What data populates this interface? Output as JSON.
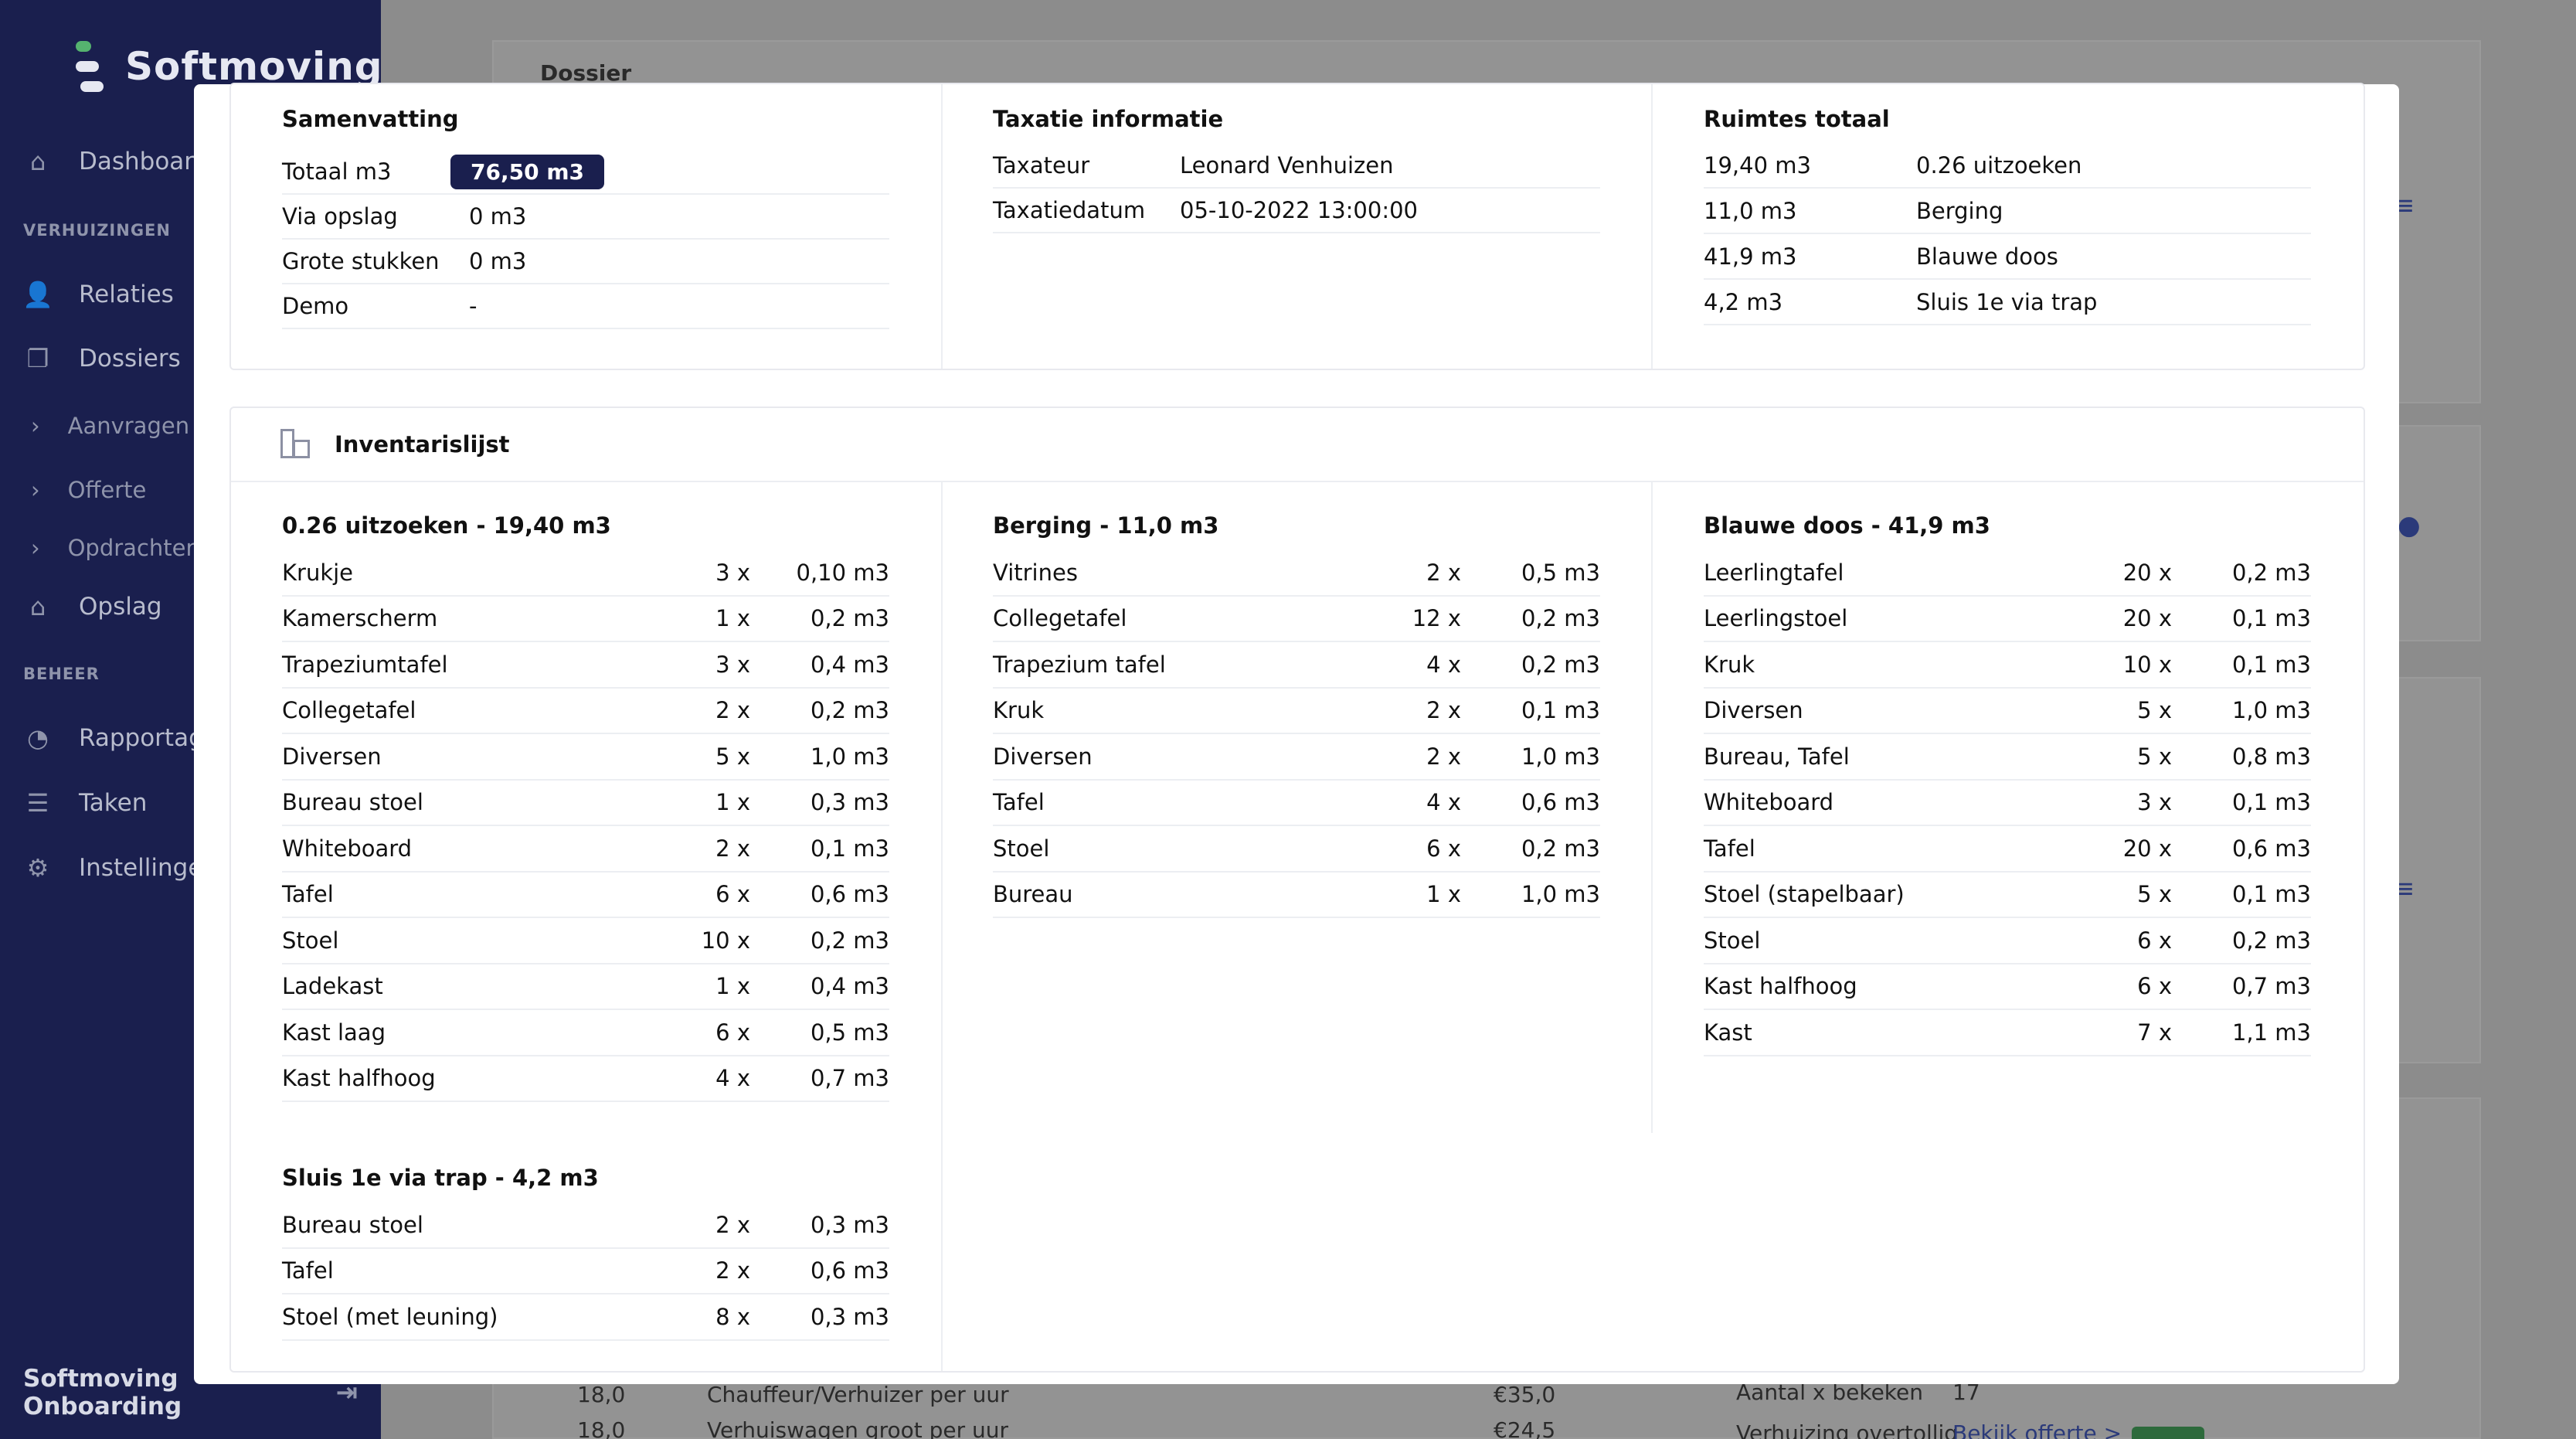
{
  "app": {
    "brand": "Softmoving",
    "account": "Softmoving Onboarding"
  },
  "sidebar": {
    "items": [
      {
        "label": "Dashboard",
        "icon": "home-icon"
      },
      {
        "label": "Relaties",
        "icon": "user-icon"
      },
      {
        "label": "Dossiers",
        "icon": "copy-icon"
      },
      {
        "label": "Aanvragen",
        "icon": "chevron-right-icon"
      },
      {
        "label": "Offerte",
        "icon": "chevron-right-icon"
      },
      {
        "label": "Opdrachten",
        "icon": "chevron-right-icon"
      },
      {
        "label": "Opslag",
        "icon": "warehouse-icon"
      },
      {
        "label": "Rapportage",
        "icon": "gauge-icon"
      },
      {
        "label": "Taken",
        "icon": "list-icon"
      },
      {
        "label": "Instellingen",
        "icon": "gear-icon"
      }
    ],
    "sections": [
      "VERHUIZINGEN",
      "BEHEER"
    ]
  },
  "background": {
    "dossier_title": "Dossier",
    "rows": [
      {
        "qty": "18,0",
        "desc": "Chauffeur/Verhuizer per uur",
        "price": "€35,0"
      },
      {
        "qty": "18,0",
        "desc": "Verhuiswagen groot per uur",
        "price": "€24,5"
      }
    ],
    "aantal_label": "Aantal x bekeken",
    "aantal_value": "17",
    "overtollig_label": "Verhuizing overtollig",
    "offerte_link": "Bekijk offerte >"
  },
  "summary": {
    "title": "Samenvatting",
    "rows": [
      {
        "label": "Totaal m3",
        "value": "76,50 m3"
      },
      {
        "label": "Via opslag",
        "value": "0 m3"
      },
      {
        "label": "Grote stukken",
        "value": "0 m3"
      },
      {
        "label": "Demo",
        "value": "-"
      }
    ]
  },
  "taxatie": {
    "title": "Taxatie informatie",
    "rows": [
      {
        "label": "Taxateur",
        "value": "Leonard Venhuizen"
      },
      {
        "label": "Taxatiedatum",
        "value": "05-10-2022 13:00:00"
      }
    ]
  },
  "ruimtes": {
    "title": "Ruimtes totaal",
    "rows": [
      {
        "label": "19,40 m3",
        "value": "0.26 uitzoeken"
      },
      {
        "label": "11,0 m3",
        "value": "Berging"
      },
      {
        "label": "41,9 m3",
        "value": "Blauwe doos"
      },
      {
        "label": "4,2 m3",
        "value": "Sluis 1e via trap"
      }
    ]
  },
  "inventaris": {
    "title": "Inventarislijst",
    "groups": [
      {
        "title": "0.26 uitzoeken - 19,40 m3",
        "items": [
          {
            "name": "Krukje",
            "qty": "3 x",
            "vol": "0,10 m3"
          },
          {
            "name": "Kamerscherm",
            "qty": "1 x",
            "vol": "0,2 m3"
          },
          {
            "name": "Trapeziumtafel",
            "qty": "3 x",
            "vol": "0,4 m3"
          },
          {
            "name": "Collegetafel",
            "qty": "2 x",
            "vol": "0,2 m3"
          },
          {
            "name": "Diversen",
            "qty": "5 x",
            "vol": "1,0 m3"
          },
          {
            "name": "Bureau stoel",
            "qty": "1 x",
            "vol": "0,3 m3"
          },
          {
            "name": "Whiteboard",
            "qty": "2 x",
            "vol": "0,1 m3"
          },
          {
            "name": "Tafel",
            "qty": "6 x",
            "vol": "0,6 m3"
          },
          {
            "name": "Stoel",
            "qty": "10 x",
            "vol": "0,2 m3"
          },
          {
            "name": "Ladekast",
            "qty": "1 x",
            "vol": "0,4 m3"
          },
          {
            "name": "Kast laag",
            "qty": "6 x",
            "vol": "0,5 m3"
          },
          {
            "name": "Kast halfhoog",
            "qty": "4 x",
            "vol": "0,7 m3"
          }
        ]
      },
      {
        "title": "Berging - 11,0 m3",
        "items": [
          {
            "name": "Vitrines",
            "qty": "2 x",
            "vol": "0,5 m3"
          },
          {
            "name": "Collegetafel",
            "qty": "12 x",
            "vol": "0,2 m3"
          },
          {
            "name": "Trapezium tafel",
            "qty": "4 x",
            "vol": "0,2 m3"
          },
          {
            "name": "Kruk",
            "qty": "2 x",
            "vol": "0,1 m3"
          },
          {
            "name": "Diversen",
            "qty": "2 x",
            "vol": "1,0 m3"
          },
          {
            "name": "Tafel",
            "qty": "4 x",
            "vol": "0,6 m3"
          },
          {
            "name": "Stoel",
            "qty": "6 x",
            "vol": "0,2 m3"
          },
          {
            "name": "Bureau",
            "qty": "1 x",
            "vol": "1,0 m3"
          }
        ]
      },
      {
        "title": "Blauwe doos - 41,9 m3",
        "items": [
          {
            "name": "Leerlingtafel",
            "qty": "20 x",
            "vol": "0,2 m3"
          },
          {
            "name": "Leerlingstoel",
            "qty": "20 x",
            "vol": "0,1 m3"
          },
          {
            "name": "Kruk",
            "qty": "10 x",
            "vol": "0,1 m3"
          },
          {
            "name": "Diversen",
            "qty": "5 x",
            "vol": "1,0 m3"
          },
          {
            "name": "Bureau, Tafel",
            "qty": "5 x",
            "vol": "0,8 m3"
          },
          {
            "name": "Whiteboard",
            "qty": "3 x",
            "vol": "0,1 m3"
          },
          {
            "name": "Tafel",
            "qty": "20 x",
            "vol": "0,6 m3"
          },
          {
            "name": "Stoel (stapelbaar)",
            "qty": "5 x",
            "vol": "0,1 m3"
          },
          {
            "name": "Stoel",
            "qty": "6 x",
            "vol": "0,2 m3"
          },
          {
            "name": "Kast halfhoog",
            "qty": "6 x",
            "vol": "0,7 m3"
          },
          {
            "name": "Kast",
            "qty": "7 x",
            "vol": "1,1 m3"
          }
        ]
      },
      {
        "title": "Sluis 1e via trap - 4,2 m3",
        "items": [
          {
            "name": "Bureau stoel",
            "qty": "2 x",
            "vol": "0,3 m3"
          },
          {
            "name": "Tafel",
            "qty": "2 x",
            "vol": "0,6 m3"
          },
          {
            "name": "Stoel (met leuning)",
            "qty": "8 x",
            "vol": "0,3 m3"
          }
        ]
      }
    ]
  },
  "colors": {
    "sidebar": "#1a1f4e",
    "accent_green": "#55b26f",
    "badge": "#1a1f4e"
  }
}
